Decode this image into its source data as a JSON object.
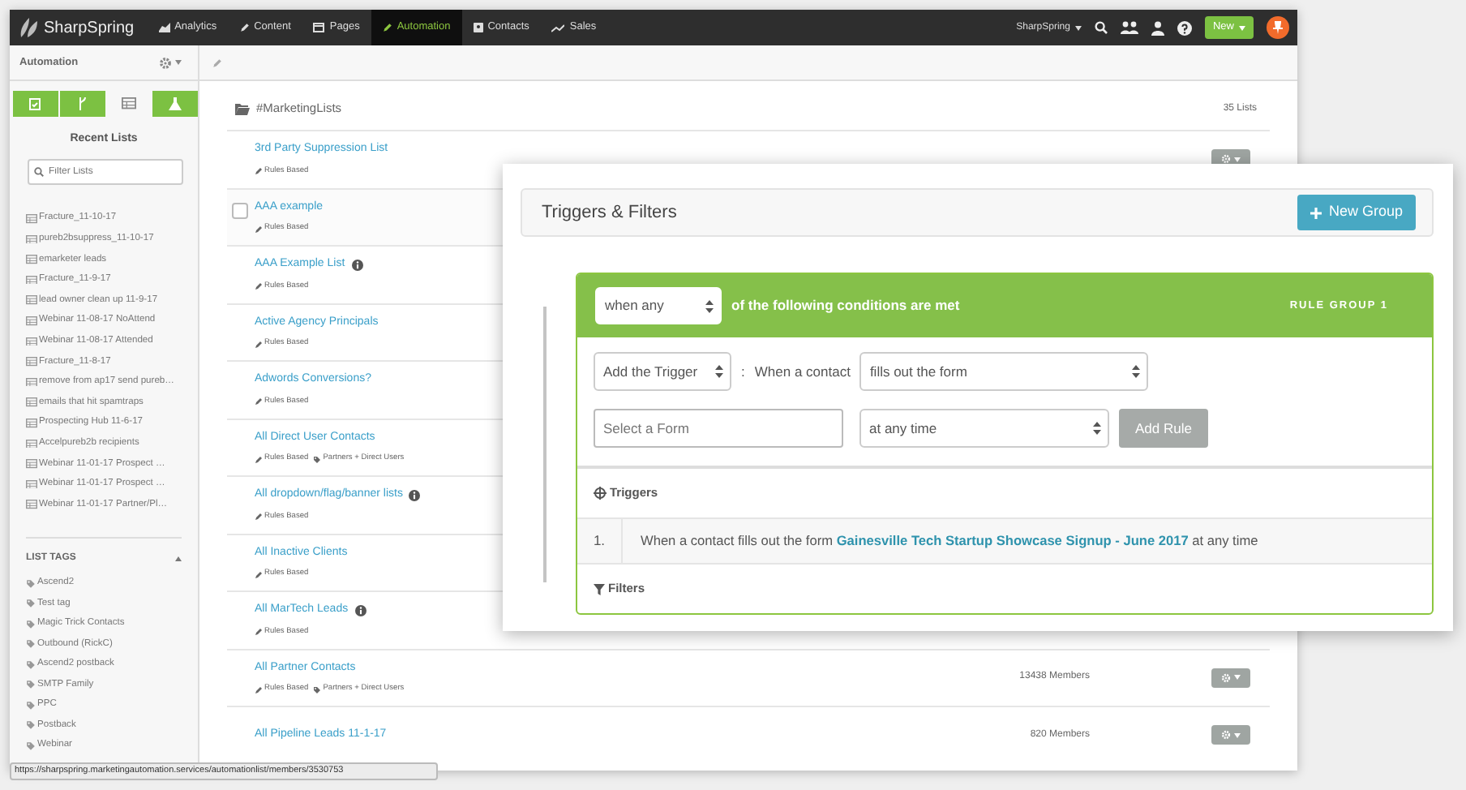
{
  "nav": {
    "brand": "SharpSpring",
    "items": [
      {
        "label": "Analytics",
        "selected": false
      },
      {
        "label": "Content",
        "selected": false
      },
      {
        "label": "Pages",
        "selected": false
      },
      {
        "label": "Automation",
        "selected": true
      },
      {
        "label": "Contacts",
        "selected": false
      },
      {
        "label": "Sales",
        "selected": false
      }
    ],
    "account": "SharpSpring",
    "new_button": "New"
  },
  "sidebar": {
    "title": "Automation",
    "tabs": [
      {
        "selected": false
      },
      {
        "selected": false
      },
      {
        "selected": true
      },
      {
        "selected": false
      }
    ],
    "recent_heading": "Recent Lists",
    "filter": {
      "placeholder": "Filter Lists"
    },
    "recent_lists": [
      "Fracture_11-10-17",
      "pureb2bsuppress_11-10-17",
      "emarketer leads",
      "Fracture_11-9-17",
      "lead owner clean up 11-9-17",
      "Webinar 11-08-17 NoAttend",
      "Webinar 11-08-17 Attended",
      "Fracture_11-8-17",
      "remove from ap17 send pureb…",
      "emails that hit spamtraps",
      "Prospecting Hub 11-6-17",
      "Accelpureb2b recipients",
      "Webinar 11-01-17 Prospect …",
      "Webinar 11-01-17 Prospect …",
      "Webinar 11-01-17 Partner/Pl…"
    ],
    "tags_heading": "LIST TAGS",
    "tags_expanded": true,
    "tags": [
      "Ascend2",
      "Test tag",
      "Magic Trick Contacts",
      "Outbound (RickC)",
      "Ascend2 postback",
      "SMTP Family",
      "PPC",
      "Postback",
      "Webinar"
    ]
  },
  "list": {
    "folder": "#MarketingLists",
    "count": "35 Lists",
    "rows": [
      {
        "title": "3rd Party Suppression List",
        "info": false,
        "hovered": false,
        "tags": [
          {
            "kind": "rule",
            "label": "Rules Based"
          }
        ]
      },
      {
        "title": "AAA example",
        "info": false,
        "hovered": true,
        "checked": false,
        "tags": [
          {
            "kind": "rule",
            "label": "Rules Based"
          }
        ]
      },
      {
        "title": "AAA Example List",
        "info": true,
        "hovered": false,
        "tags": [
          {
            "kind": "rule",
            "label": "Rules Based"
          }
        ]
      },
      {
        "title": "Active Agency Principals",
        "info": false,
        "hovered": false,
        "tags": [
          {
            "kind": "rule",
            "label": "Rules Based"
          }
        ]
      },
      {
        "title": "Adwords Conversions?",
        "info": false,
        "hovered": false,
        "tags": [
          {
            "kind": "rule",
            "label": "Rules Based"
          }
        ]
      },
      {
        "title": "All Direct User Contacts",
        "info": false,
        "hovered": false,
        "tags": [
          {
            "kind": "rule",
            "label": "Rules Based"
          },
          {
            "kind": "tag",
            "label": "Partners + Direct Users"
          }
        ]
      },
      {
        "title": "All dropdown/flag/banner lists",
        "info": true,
        "hovered": false,
        "tags": [
          {
            "kind": "rule",
            "label": "Rules Based"
          }
        ]
      },
      {
        "title": "All Inactive Clients",
        "info": false,
        "hovered": false,
        "tags": [
          {
            "kind": "rule",
            "label": "Rules Based"
          }
        ]
      },
      {
        "title": "All MarTech Leads",
        "info": true,
        "hovered": false,
        "tags": [
          {
            "kind": "rule",
            "label": "Rules Based"
          }
        ]
      },
      {
        "title": "All Partner Contacts",
        "info": false,
        "hovered": false,
        "members": "13438 Members",
        "tags": [
          {
            "kind": "rule",
            "label": "Rules Based"
          },
          {
            "kind": "tag",
            "label": "Partners + Direct Users"
          }
        ]
      },
      {
        "title": "All Pipeline Leads 11-1-17",
        "info": false,
        "hovered": false,
        "members": "820 Members"
      }
    ]
  },
  "rules_panel": {
    "title": "Triggers & Filters",
    "new_group_button": "New Group",
    "group": {
      "match_select": "when any",
      "match_text": "of the following conditions are met",
      "label": "RULE GROUP 1",
      "trigger_select": "Add the Trigger",
      "separator": ":",
      "when_text": "When a contact",
      "action_select": "fills out the form",
      "form_field": {
        "placeholder": "Select a Form"
      },
      "time_select": "at any time",
      "add_rule_button": "Add Rule",
      "add_rule_disabled": true,
      "triggers_heading": "Triggers",
      "triggers": [
        {
          "number": "1.",
          "prefix": "When a contact fills out the form",
          "form": "Gainesville Tech Startup Showcase Signup - June 2017",
          "suffix": "at any time"
        }
      ],
      "filters_heading": "Filters"
    }
  },
  "status_url": "https://sharpspring.marketingautomation.services/automationlist/members/3530753"
}
